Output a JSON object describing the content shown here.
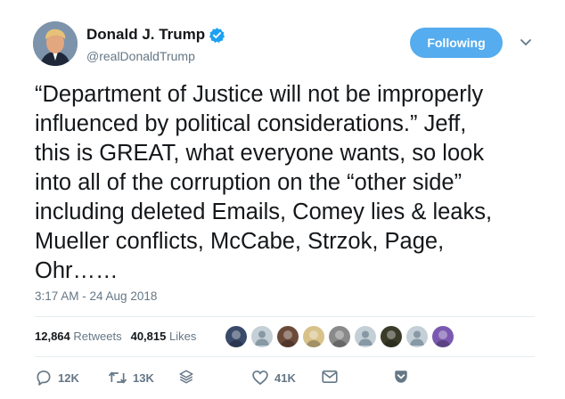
{
  "user": {
    "display_name": "Donald J. Trump",
    "handle": "@realDonaldTrump",
    "verified_icon": "verified-badge-icon"
  },
  "follow_button": {
    "label": "Following"
  },
  "tweet": {
    "text": "“Department of Justice will not be improperly\ninfluenced by political considerations.” Jeff,\nthis is GREAT, what everyone wants, so look\ninto all of the corruption on the “other side”\nincluding deleted Emails, Comey lies & leaks,\nMueller conflicts, McCabe, Strzok, Page,\nOhr……",
    "timestamp": "3:17 AM - 24 Aug 2018"
  },
  "stats": {
    "retweets_count": "12,864",
    "retweets_label": "Retweets",
    "likes_count": "40,815",
    "likes_label": "Likes"
  },
  "likers": [
    {
      "color": "#3a4a6b"
    },
    {
      "color": "#c4cfd6"
    },
    {
      "color": "#6b4a3a"
    },
    {
      "color": "#d8c28a"
    },
    {
      "color": "#8a8a8a"
    },
    {
      "color": "#c4cfd6"
    },
    {
      "color": "#3b3b2a"
    },
    {
      "color": "#c4cfd6"
    },
    {
      "color": "#7a5ab0"
    }
  ],
  "actions": {
    "reply_count": "12K",
    "retweet_count": "13K",
    "like_count": "41K"
  },
  "colors": {
    "accent": "#55acee",
    "secondary_text": "#657786",
    "divider": "#e6ecf0"
  }
}
